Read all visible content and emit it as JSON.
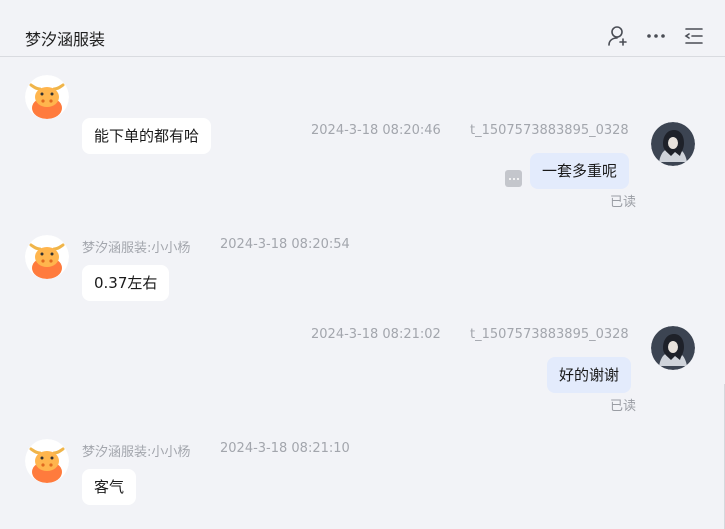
{
  "header": {
    "title": "梦汐涵服装",
    "icons": [
      "user-add-icon",
      "more-icon",
      "menu-icon"
    ]
  },
  "messages": [
    {
      "id": "m1",
      "direction": "in",
      "text": "能下单的都有哈"
    },
    {
      "id": "m2",
      "direction": "out",
      "time": "2024-3-18 08:20:46",
      "sender": "t_1507573883895_0328",
      "text": "一套多重呢",
      "status": "已读"
    },
    {
      "id": "m3",
      "direction": "in",
      "sender": "梦汐涵服装:小小杨",
      "time": "2024-3-18 08:20:54",
      "text": "0.37左右"
    },
    {
      "id": "m4",
      "direction": "out",
      "time": "2024-3-18 08:21:02",
      "sender": "t_1507573883895_0328",
      "text": "好的谢谢",
      "status": "已读"
    },
    {
      "id": "m5",
      "direction": "in",
      "sender": "梦汐涵服装:小小杨",
      "time": "2024-3-18 08:21:10",
      "text": "客气"
    }
  ],
  "colors": {
    "background": "#f2f3f7",
    "incoming_bubble": "#ffffff",
    "outgoing_bubble": "#e3ebfc",
    "meta_text": "#a3a6ad"
  }
}
